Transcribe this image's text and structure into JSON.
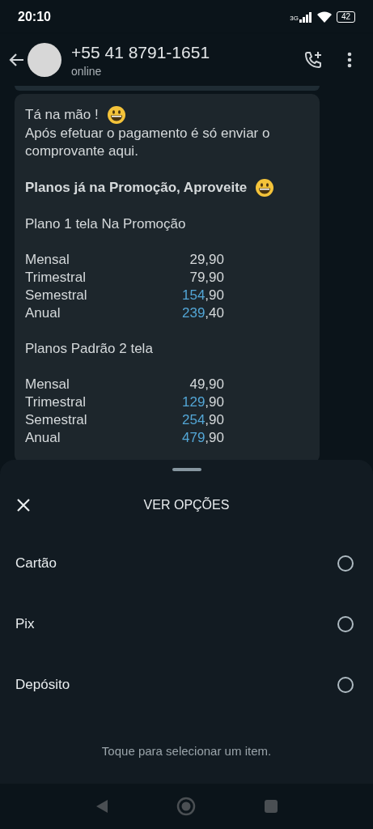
{
  "status_bar": {
    "time": "20:10",
    "network": "3G",
    "battery": "42"
  },
  "header": {
    "title": "+55 41 8791-1651",
    "subtitle": "online"
  },
  "message": {
    "blocks": [
      {
        "kind": "line",
        "text": "Tá na mão !",
        "emoji": true
      },
      {
        "kind": "line",
        "text": "Após efetuar o pagamento é só enviar o comprovante aqui."
      },
      {
        "kind": "gap"
      },
      {
        "kind": "bold",
        "text": "Planos já na  Promoção, Aproveite",
        "emoji": true
      },
      {
        "kind": "gap"
      },
      {
        "kind": "line",
        "text": "Plano 1 tela Na Promoção"
      },
      {
        "kind": "gap"
      },
      {
        "kind": "prices",
        "rows": [
          {
            "label": "Mensal",
            "parts": [
              {
                "text": "29,90",
                "link": false
              }
            ]
          },
          {
            "label": "Trimestral",
            "parts": [
              {
                "text": "79,90",
                "link": false
              }
            ]
          },
          {
            "label": "Semestral",
            "parts": [
              {
                "text": "154",
                "link": true
              },
              {
                "text": ",90",
                "link": false
              }
            ]
          },
          {
            "label": "Anual",
            "parts": [
              {
                "text": "239",
                "link": true
              },
              {
                "text": ",40",
                "link": false
              }
            ]
          }
        ]
      },
      {
        "kind": "gap"
      },
      {
        "kind": "line",
        "text": "Planos Padrão 2 tela"
      },
      {
        "kind": "gap"
      },
      {
        "kind": "prices",
        "rows": [
          {
            "label": "Mensal",
            "parts": [
              {
                "text": "49,90",
                "link": false
              }
            ]
          },
          {
            "label": "Trimestral",
            "parts": [
              {
                "text": "129",
                "link": true
              },
              {
                "text": ",90",
                "link": false
              }
            ]
          },
          {
            "label": "Semestral",
            "parts": [
              {
                "text": "254",
                "link": true
              },
              {
                "text": ",90",
                "link": false
              }
            ]
          },
          {
            "label": "Anual",
            "parts": [
              {
                "text": "479",
                "link": true
              },
              {
                "text": ",90",
                "link": false
              }
            ]
          }
        ]
      }
    ]
  },
  "sheet": {
    "title": "VER OPÇÕES",
    "options": [
      {
        "label": "Cartão",
        "selected": false
      },
      {
        "label": "Pix",
        "selected": false
      },
      {
        "label": "Depósito",
        "selected": false
      }
    ],
    "hint": "Toque para selecionar um item."
  }
}
